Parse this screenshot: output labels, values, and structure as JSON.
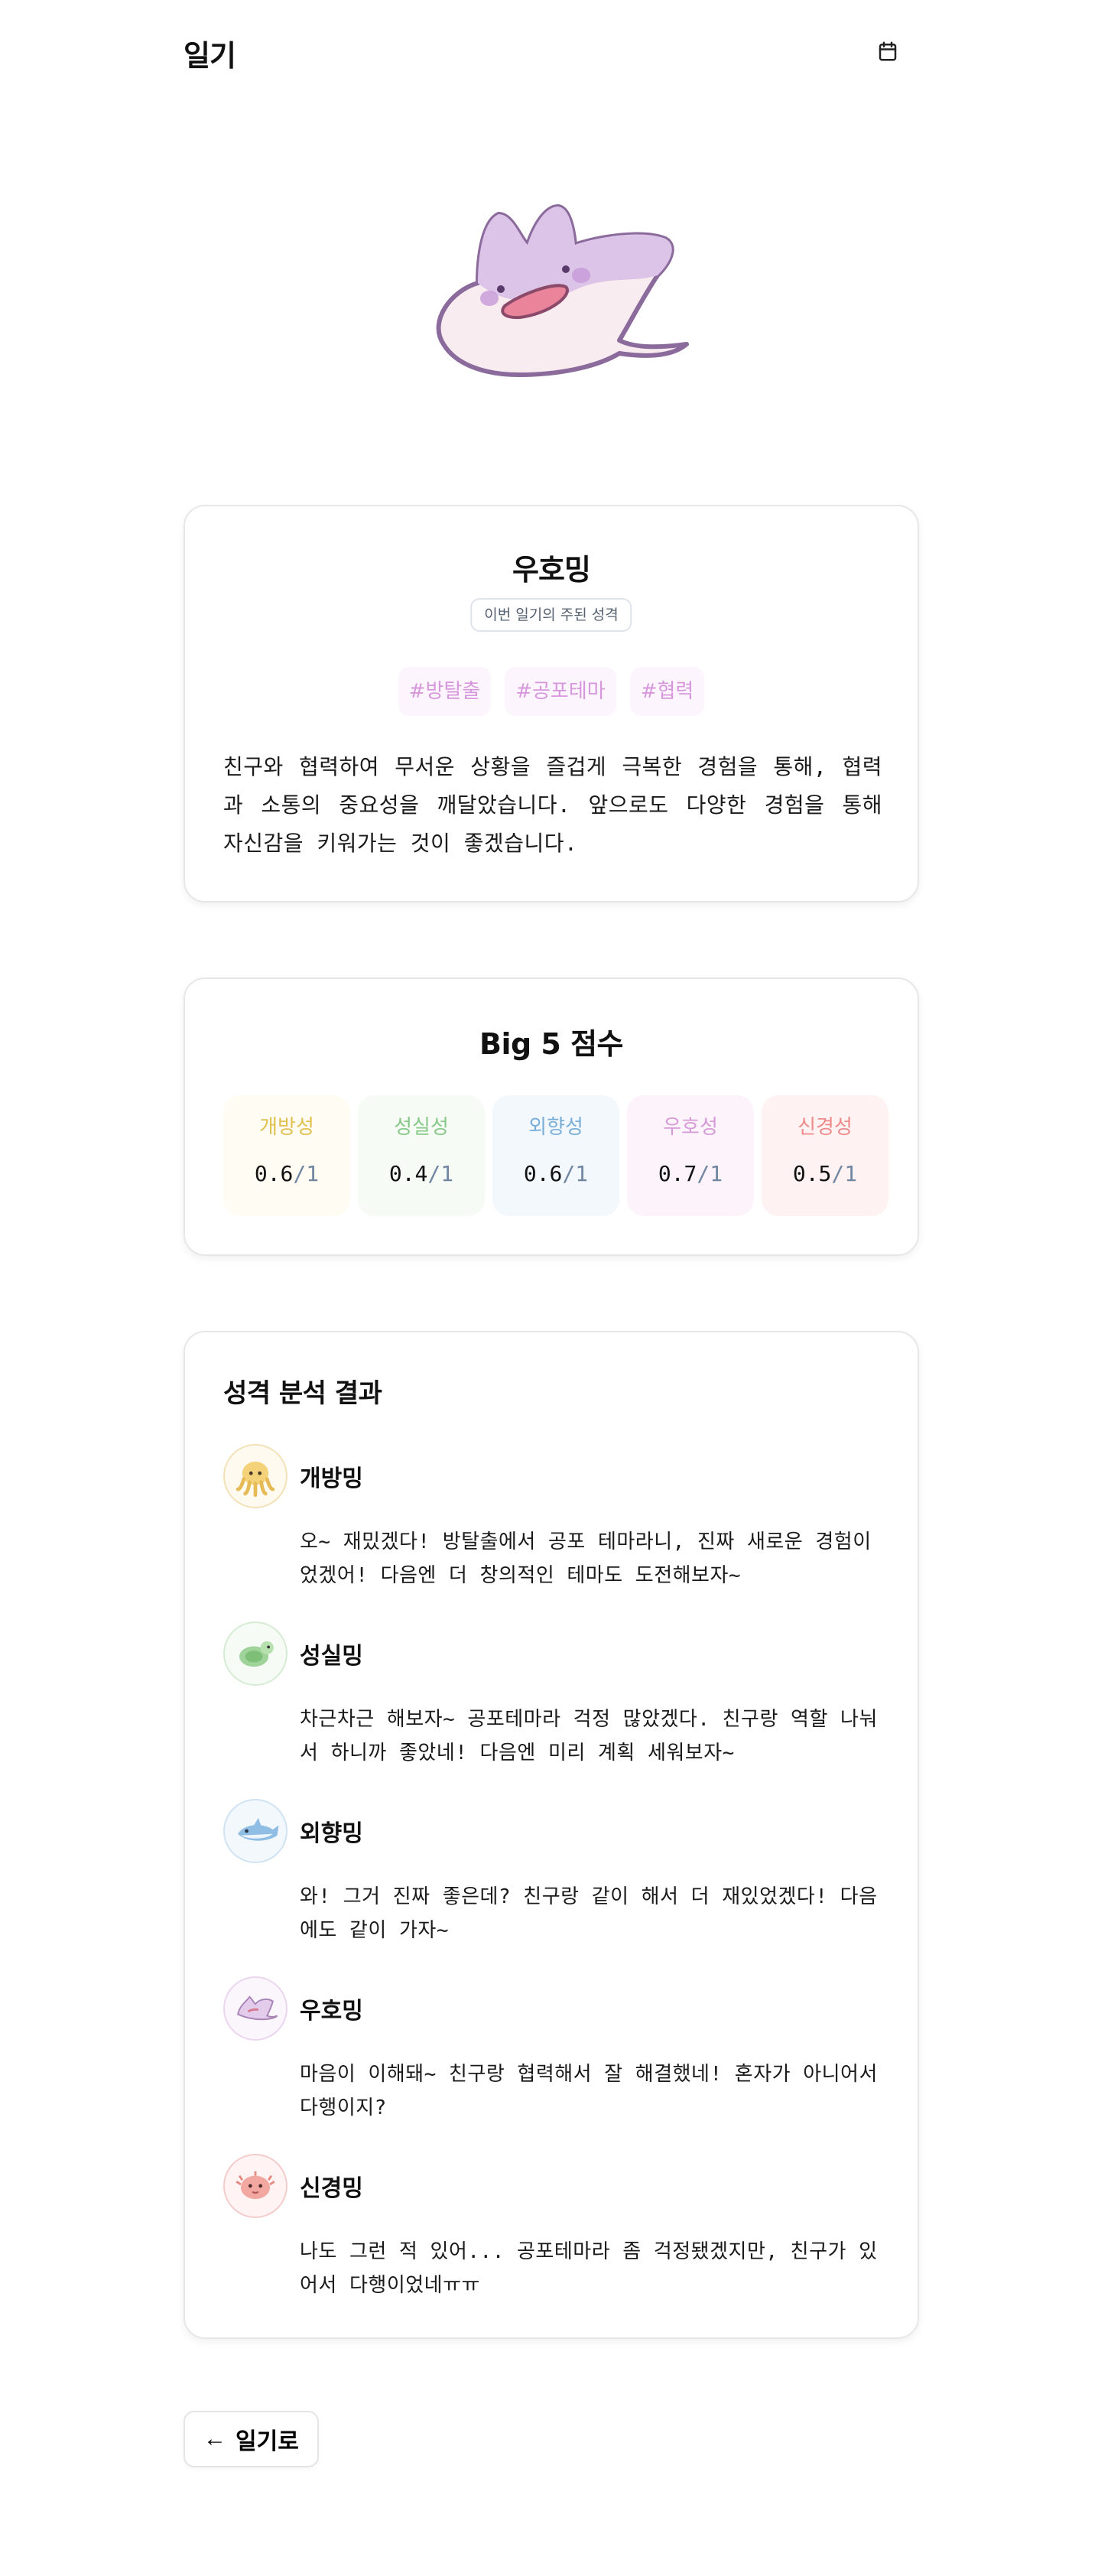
{
  "header": {
    "title": "일기",
    "calendar_icon": "calendar-icon"
  },
  "hero": {
    "illustration": "purple-stingray-mascot"
  },
  "character": {
    "name": "우호밍",
    "badge": "이번 일기의 주된 성격",
    "tags": [
      "#방탈출",
      "#공포테마",
      "#협력"
    ],
    "description": "친구와 협력하여 무서운 상황을 즐겁게 극복한 경험을 통해, 협력과 소통의 중요성을 깨달았습니다. 앞으로도 다양한 경험을 통해 자신감을 키워가는 것이 좋겠습니다."
  },
  "big5": {
    "title": "Big 5 점수",
    "scores": [
      {
        "label": "개방성",
        "value": "0.6",
        "max": "/1",
        "color": "#e0c050"
      },
      {
        "label": "성실성",
        "value": "0.4",
        "max": "/1",
        "color": "#88c888"
      },
      {
        "label": "외향성",
        "value": "0.6",
        "max": "/1",
        "color": "#7aaed8"
      },
      {
        "label": "우호성",
        "value": "0.7",
        "max": "/1",
        "color": "#d69ad8"
      },
      {
        "label": "신경성",
        "value": "0.5",
        "max": "/1",
        "color": "#ee8a8a"
      }
    ]
  },
  "analysis": {
    "title": "성격 분석 결과",
    "items": [
      {
        "name": "개방밍",
        "icon": "octopus-icon",
        "message": "오~ 재밌겠다! 방탈출에서 공포 테마라니, 진짜 새로운 경험이었겠어! 다음엔 더 창의적인 테마도 도전해보자~"
      },
      {
        "name": "성실밍",
        "icon": "turtle-icon",
        "message": "차근차근 해보자~ 공포테마라 걱정 많았겠다. 친구랑 역할 나눠서 하니까 좋았네! 다음엔 미리 계획 세워보자~"
      },
      {
        "name": "외향밍",
        "icon": "shark-icon",
        "message": "와! 그거 진짜 좋은데? 친구랑 같이 해서 더 재있었겠다! 다음에도 같이 가자~"
      },
      {
        "name": "우호밍",
        "icon": "stingray-icon",
        "message": "마음이 이해돼~ 친구랑 협력해서 잘 해결했네! 혼자가 아니어서 다행이지?"
      },
      {
        "name": "신경밍",
        "icon": "pufferfish-icon",
        "message": "나도 그런 적 있어... 공포테마라 좀 걱정됐겠지만, 친구가 있어서 다행이었네ㅠㅠ"
      }
    ]
  },
  "footer": {
    "back_label": "일기로",
    "back_icon": "arrow-left-icon"
  }
}
